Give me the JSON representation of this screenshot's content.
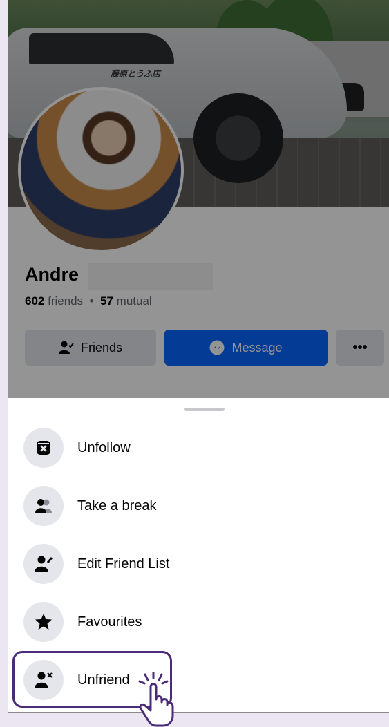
{
  "profile": {
    "name": "Andre",
    "friends_count": "602",
    "friends_label": "friends",
    "separator": "•",
    "mutual_count": "57",
    "mutual_label": "mutual",
    "cover_text": "藤原とうふ店"
  },
  "actions": {
    "friends_label": "Friends",
    "message_label": "Message",
    "more_label": "•••"
  },
  "sheet": {
    "items": [
      {
        "label": "Unfollow",
        "icon": "unfollow-icon"
      },
      {
        "label": "Take a break",
        "icon": "people-icon"
      },
      {
        "label": "Edit Friend List",
        "icon": "edit-friend-icon"
      },
      {
        "label": "Favourites",
        "icon": "star-icon"
      },
      {
        "label": "Unfriend",
        "icon": "unfriend-icon"
      }
    ]
  },
  "colors": {
    "accent": "#0866ff",
    "highlight": "#4b2a78",
    "background": "#ece6f3"
  }
}
